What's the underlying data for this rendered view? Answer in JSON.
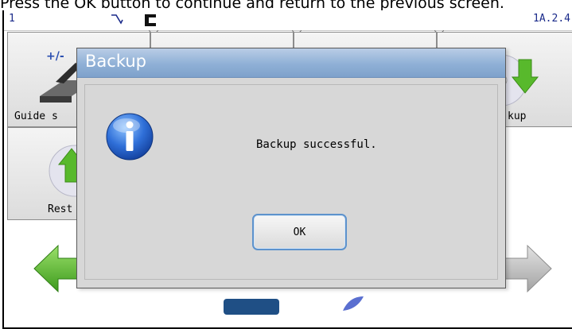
{
  "instruction_banner": "Press the OK button to continue and return to the previous screen.",
  "statusbar": {
    "left_text": "1",
    "right_text": "1A.2.4",
    "icons": [
      "wrench-icon",
      "device-icon"
    ]
  },
  "tiles": [
    {
      "label": "Guide s",
      "icon": "guide-setup-icon",
      "icon_text": "+/-"
    },
    {
      "label": "kup",
      "icon": "backup-disc-icon"
    },
    {
      "label": "Rest",
      "icon": "restore-disc-icon"
    }
  ],
  "navigation": {
    "back_icon": "back-arrow-icon",
    "forward_icon": "forward-arrow-icon"
  },
  "dialog": {
    "title": "Backup",
    "message": "Backup successful.",
    "icon": "info-icon",
    "ok_label": "OK"
  },
  "colors": {
    "titlebar": "#8fb0d6",
    "dialog_bg": "#d7d7d7",
    "ok_border": "#5d92cc",
    "arrow_green": "#5cbd2f",
    "arrow_grey": "#b9b9b9"
  }
}
